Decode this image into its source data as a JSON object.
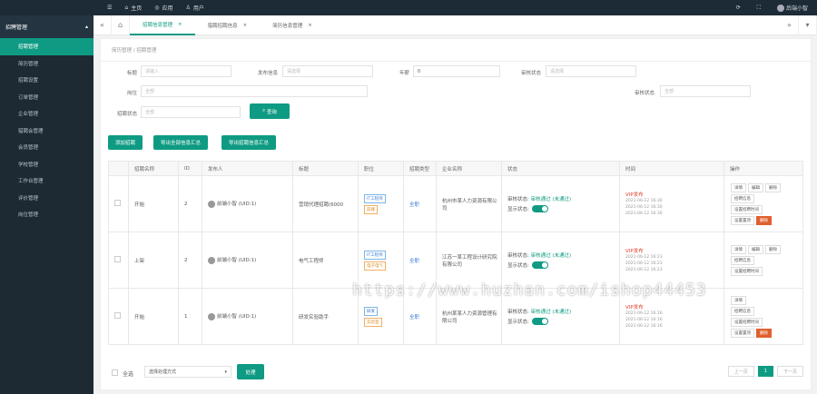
{
  "topbar": {
    "nav": [
      "主页",
      "应用",
      "用户"
    ],
    "user": "后端小智"
  },
  "sidebar": {
    "section": "招聘管理",
    "items": [
      "招聘管理",
      "简历管理",
      "招聘设置",
      "订单管理",
      "企业管理",
      "猎聘会管理",
      "会员管理",
      "学校管理",
      "工作台管理",
      "评价管理",
      "岗位管理"
    ]
  },
  "tabs": [
    "招聘信息管理",
    "猎聘招聘信息",
    "简历信息管理"
  ],
  "breadcrumb": "简历管理 / 招聘管理",
  "form": {
    "labels": {
      "title": "标题",
      "recruiter": "发布信息",
      "salary": "年薪",
      "status": "审核状态",
      "position": "岗位",
      "review": "审核状态",
      "recruit_status": "招聘状态"
    },
    "placeholders": {
      "title": "请输入",
      "recruiter": "请选择",
      "salary": "0",
      "status": "请选择",
      "position": "全部",
      "review": "全部",
      "recruit_status": "全部"
    },
    "search_button": "查询"
  },
  "actions": [
    "添加招聘",
    "导出全部信息汇总",
    "导出招聘信息汇总"
  ],
  "table": {
    "headers": [
      "",
      "招聘名称",
      "ID",
      "发布人",
      "标题",
      "职位",
      "招聘类型",
      "企业名称",
      "状态",
      "时间",
      "操作"
    ],
    "rows": [
      {
        "name": "开始",
        "id": "2",
        "publisher": "前端小智 (UID:1)",
        "title": "营销代理招聘(6000",
        "tags": [
          "IT工程师",
          "前端"
        ],
        "type": "全职",
        "company": "杭州市某人力资源有限公司",
        "review_label": "审核状态:",
        "review_value": "审核通过 (未通过)",
        "show_label": "显示状态:",
        "time_status": "VIP发布",
        "times": [
          "2021-06-12 16:30",
          "2021-06-12 16:30",
          "2021-06-12 16:30"
        ],
        "ops": [
          "详情",
          "编辑",
          "删除",
          "招聘信息",
          "设置招聘时间",
          "设置置顶",
          "删除"
        ]
      },
      {
        "name": "上架",
        "id": "2",
        "publisher": "前端小智 (UID:1)",
        "title": "电气工程师",
        "tags": [
          "IT工程师",
          "电子电气"
        ],
        "type": "全职",
        "company": "江苏一某工程设计研究院有限公司",
        "review_label": "审核状态:",
        "review_value": "审核通过 (未通过)",
        "show_label": "显示状态:",
        "time_status": "VIP发布",
        "times": [
          "2021-06-12 16:23",
          "2021-06-12 16:23",
          "2021-06-12 16:23"
        ],
        "ops": [
          "详情",
          "编辑",
          "删除",
          "招聘信息",
          "设置招聘时间"
        ]
      },
      {
        "name": "开始",
        "id": "1",
        "publisher": "前端小智 (UID:1)",
        "title": "研发实验助手",
        "tags": [
          "研发",
          "实验室"
        ],
        "type": "全职",
        "company": "杭州某某人力资源管理有限公司",
        "review_label": "审核状态:",
        "review_value": "审核通过 (未通过)",
        "show_label": "显示状态:",
        "time_status": "VIP发布",
        "times": [
          "2021-06-12 16:16",
          "2021-06-12 16:16",
          "2021-06-12 16:16"
        ],
        "ops": [
          "详情",
          "招聘信息",
          "设置招聘时间",
          "设置置顶",
          "删除"
        ]
      }
    ]
  },
  "bottom": {
    "select_all": "全选",
    "batch_placeholder": "选择处理方式",
    "confirm": "处理",
    "pager": [
      "上一页",
      "1",
      "下一页"
    ]
  },
  "watermark": "https://www.huzhan.com/ishop44453",
  "colors": {
    "accent": "#0f9b83",
    "sidebar": "#1e2a33",
    "danger": "#e06030"
  }
}
